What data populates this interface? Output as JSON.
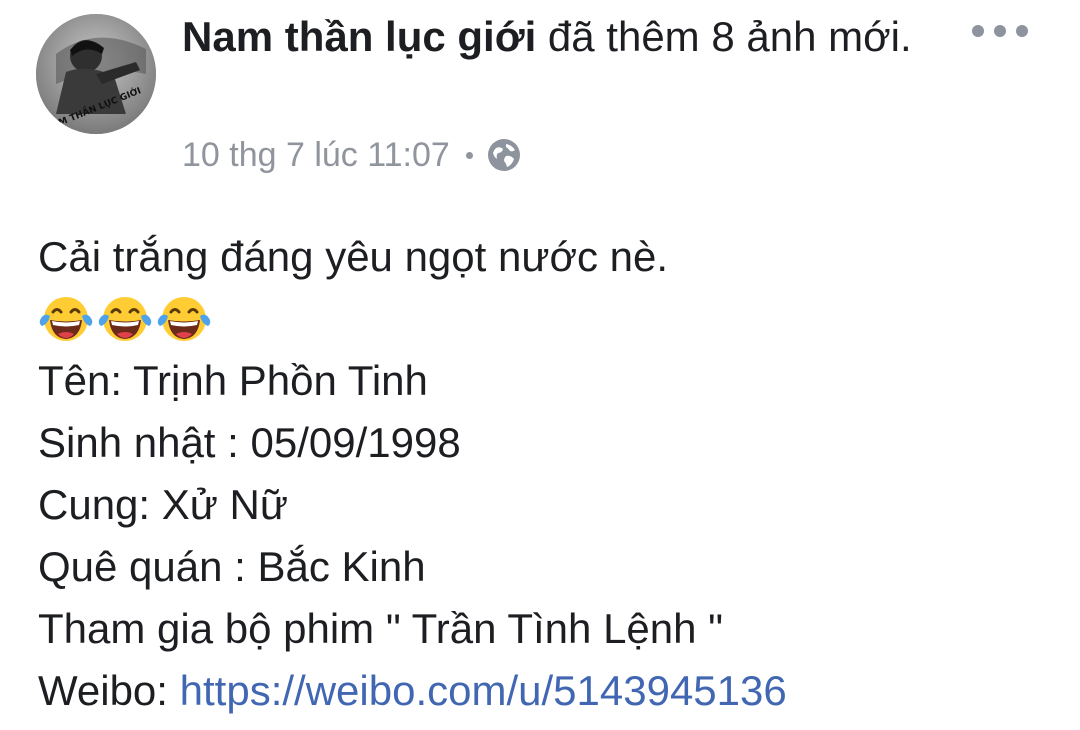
{
  "post": {
    "author": "Nam thần lục giới",
    "action": "đã thêm 8 ảnh mới.",
    "timestamp": "10 thg 7 lúc 11:07",
    "privacy_icon": "globe-icon",
    "more_icon": "more-horizontal-icon",
    "avatar_caption": "NAM THẦN LỤC GIỚI"
  },
  "content": {
    "line1": "Cải trắng đáng yêu ngọt nước nè.",
    "emoji_name": "face-with-tears-of-joy",
    "emoji_count": 3,
    "line_name": "Tên: Trịnh Phồn Tinh",
    "line_birthday": "Sinh nhật : 05/09/1998",
    "line_zodiac": "Cung: Xử Nữ",
    "line_hometown": "Quê quán : Bắc Kinh",
    "line_drama": "Tham gia bộ phim \" Trần Tình Lệnh \"",
    "weibo_label": "Weibo: ",
    "weibo_link": "https://weibo.com/u/5143945136"
  },
  "colors": {
    "text": "#1c1e21",
    "meta": "#90949c",
    "link": "#4267b2",
    "icon_gray": "#8d949e"
  }
}
